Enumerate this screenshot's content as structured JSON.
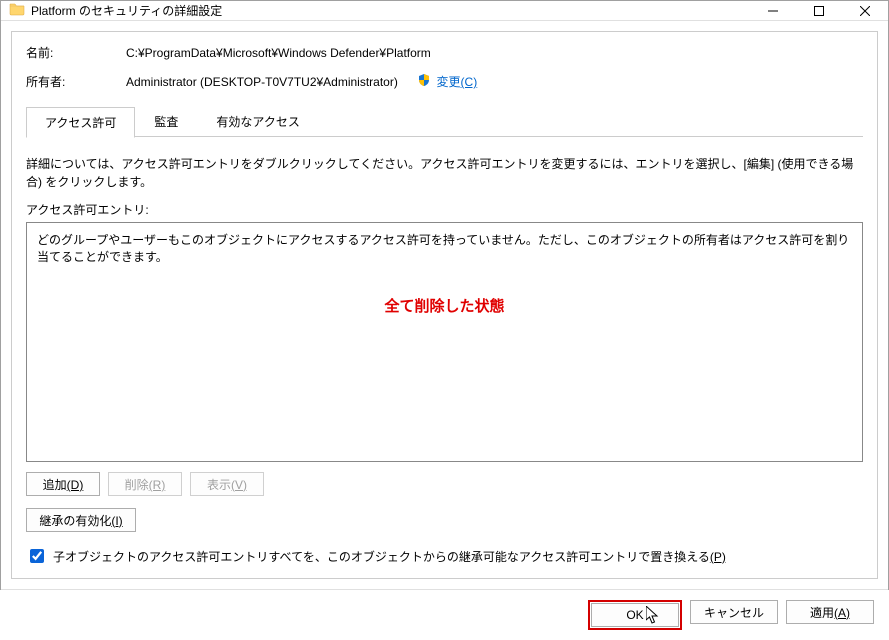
{
  "titlebar": {
    "icon": "folder-icon",
    "title": "Platform のセキュリティの詳細設定"
  },
  "fields": {
    "name_label": "名前:",
    "name_value": "C:¥ProgramData¥Microsoft¥Windows Defender¥Platform",
    "owner_label": "所有者:",
    "owner_value": "Administrator (DESKTOP-T0V7TU2¥Administrator)",
    "change_link": "変更",
    "change_accel": "(C)"
  },
  "tabs": {
    "permissions": "アクセス許可",
    "audit": "監査",
    "effective": "有効なアクセス"
  },
  "description": "詳細については、アクセス許可エントリをダブルクリックしてください。アクセス許可エントリを変更するには、エントリを選択し、[編集] (使用できる場合) をクリックします。",
  "list_label": "アクセス許可エントリ:",
  "list_empty": "どのグループやユーザーもこのオブジェクトにアクセスするアクセス許可を持っていません。ただし、このオブジェクトの所有者はアクセス許可を割り当てることができます。",
  "annotation": "全て削除した状態",
  "buttons": {
    "add": "追加",
    "add_accel": "(D)",
    "remove": "削除",
    "remove_accel": "(R)",
    "view": "表示",
    "view_accel": "(V)",
    "inherit": "継承の有効化",
    "inherit_accel": "(I)"
  },
  "checkbox_label": "子オブジェクトのアクセス許可エントリすべてを、このオブジェクトからの継承可能なアクセス許可エントリで置き換える",
  "checkbox_accel": "(P)",
  "footer": {
    "ok": "OK",
    "cancel": "キャンセル",
    "apply": "適用",
    "apply_accel": "(A)"
  }
}
